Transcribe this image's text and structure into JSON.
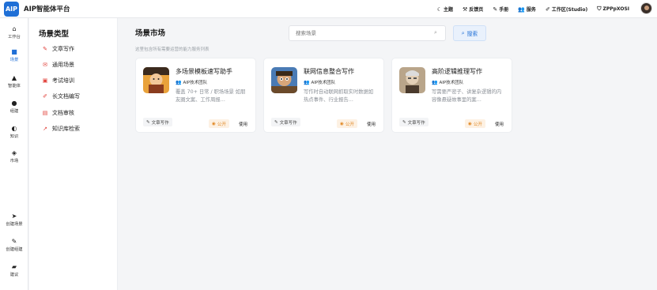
{
  "app": {
    "logo": "AIP",
    "title": "AIP智能体平台"
  },
  "topnav": [
    {
      "icon": "☾",
      "icon_name": "moon-icon",
      "label": "主题"
    },
    {
      "icon": "⚒",
      "icon_name": "tools-icon",
      "label": "反馈页"
    },
    {
      "icon": "✎",
      "icon_name": "manual-icon",
      "label": "手册"
    },
    {
      "icon": "👥",
      "icon_name": "service-icon",
      "label": "服务"
    },
    {
      "icon": "✐",
      "icon_name": "workspace-icon",
      "label": "工作区(Studio)"
    },
    {
      "icon": "⛉",
      "icon_name": "shield-icon",
      "label": "ZPPpXOSI"
    }
  ],
  "rail": [
    {
      "icon": "⌂",
      "icon_name": "home-icon",
      "label": "工作台",
      "active": false
    },
    {
      "icon": "■",
      "icon_name": "scene-icon",
      "label": "场景",
      "active": true
    },
    {
      "icon": "▲",
      "icon_name": "agent-icon",
      "label": "智能体",
      "active": false
    },
    {
      "icon": "●",
      "icon_name": "team-icon",
      "label": "组建",
      "active": false
    },
    {
      "icon": "◐",
      "icon_name": "knowledge-icon",
      "label": "知识",
      "active": false
    },
    {
      "icon": "◈",
      "icon_name": "market-icon",
      "label": "市场",
      "active": false
    },
    {
      "icon": "➤",
      "icon_name": "send-icon",
      "label": "创建场景",
      "active": false
    },
    {
      "icon": "✎",
      "icon_name": "pen-icon",
      "label": "创建组建",
      "active": false
    },
    {
      "icon": "▰",
      "icon_name": "chat-icon",
      "label": "建议",
      "active": false
    }
  ],
  "categories": {
    "title": "场景类型",
    "items": [
      {
        "icon": "✎",
        "icon_name": "article-write-icon",
        "label": "文章写作"
      },
      {
        "icon": "✉",
        "icon_name": "general-scene-icon",
        "label": "通用场景"
      },
      {
        "icon": "▣",
        "icon_name": "exam-training-icon",
        "label": "考试培训"
      },
      {
        "icon": "✐",
        "icon_name": "long-doc-icon",
        "label": "长文档编写"
      },
      {
        "icon": "▤",
        "icon_name": "doc-review-icon",
        "label": "文档审核"
      },
      {
        "icon": "↗",
        "icon_name": "knowledge-search-icon",
        "label": "知识库检索"
      }
    ]
  },
  "main": {
    "title": "场景市场",
    "subtitle": "这里包含所有需要运营的能力服务列表",
    "search_placeholder": "搜索场景",
    "search_button": "搜索"
  },
  "cards": [
    {
      "name": "多场景模板速写助手",
      "author": "AIP技术团队",
      "desc": "覆盖 70+ 日常 / 职场场景 如朋友圈文案、工作周报…",
      "tag": "文章写作",
      "badge": "公开",
      "use": "使用",
      "avatar_bg": "#e9a23b"
    },
    {
      "name": "联网信息整合写作",
      "author": "AIP技术团队",
      "desc": "写作时自动联网抓取实时数据如热点事件、行业报告…",
      "tag": "文章写作",
      "badge": "公开",
      "use": "使用",
      "avatar_bg": "#4a7bb5"
    },
    {
      "name": "高阶逻辑推理写作",
      "author": "AIP技术团队",
      "desc": "写需要严密子、讲复杂逻辑的内容像悬疑故事里的案…",
      "tag": "文章写作",
      "badge": "公开",
      "use": "使用",
      "avatar_bg": "#b9a58a"
    }
  ]
}
